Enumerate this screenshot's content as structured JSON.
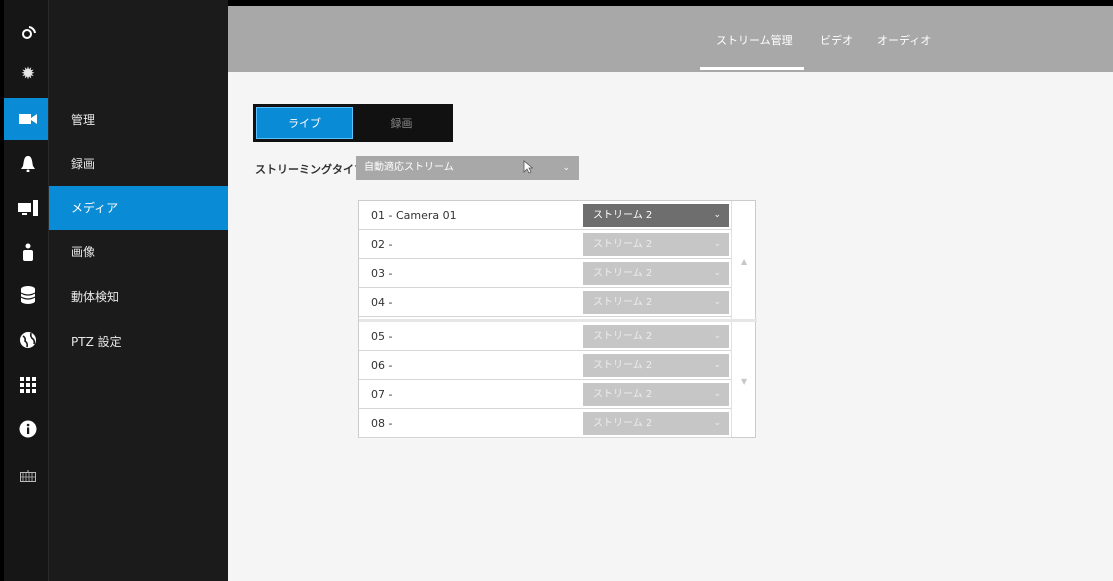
{
  "header": {
    "tabs": [
      {
        "label": "ストリーム管理"
      },
      {
        "label": "ビデオ"
      },
      {
        "label": "オーディオ"
      }
    ]
  },
  "icon_rail": {
    "items": [
      {
        "icon": "logo-icon"
      },
      {
        "icon": "gear-icon"
      },
      {
        "icon": "video-camera-icon",
        "active": true
      },
      {
        "icon": "bell-icon"
      },
      {
        "icon": "monitor-icon"
      },
      {
        "icon": "person-icon"
      },
      {
        "icon": "database-icon"
      },
      {
        "icon": "globe-icon"
      },
      {
        "icon": "grid-icon"
      },
      {
        "icon": "info-icon"
      },
      {
        "icon": "keyboard-icon"
      }
    ]
  },
  "submenu": {
    "items": [
      {
        "label": "管理"
      },
      {
        "label": "録画"
      },
      {
        "label": "メディア",
        "active": true
      },
      {
        "label": "画像"
      },
      {
        "label": "動体検知"
      },
      {
        "label": "PTZ 設定"
      }
    ]
  },
  "mode_toggle": {
    "live_label": "ライブ",
    "record_label": "録画"
  },
  "streaming_type": {
    "label": "ストリーミングタイプ",
    "value": "自動適応ストリーム"
  },
  "channels": [
    {
      "label": "01 - Camera 01",
      "stream": "ストリーム 2"
    },
    {
      "label": "02 -",
      "stream": "ストリーム 2"
    },
    {
      "label": "03 -",
      "stream": "ストリーム 2"
    },
    {
      "label": "04 -",
      "stream": "ストリーム 2"
    },
    {
      "label": "05 -",
      "stream": "ストリーム 2"
    },
    {
      "label": "06 -",
      "stream": "ストリーム 2"
    },
    {
      "label": "07 -",
      "stream": "ストリーム 2"
    },
    {
      "label": "08 -",
      "stream": "ストリーム 2"
    }
  ],
  "colors": {
    "accent": "#0a8bd6",
    "rail": "#161616",
    "header": "#a8a8a8"
  }
}
